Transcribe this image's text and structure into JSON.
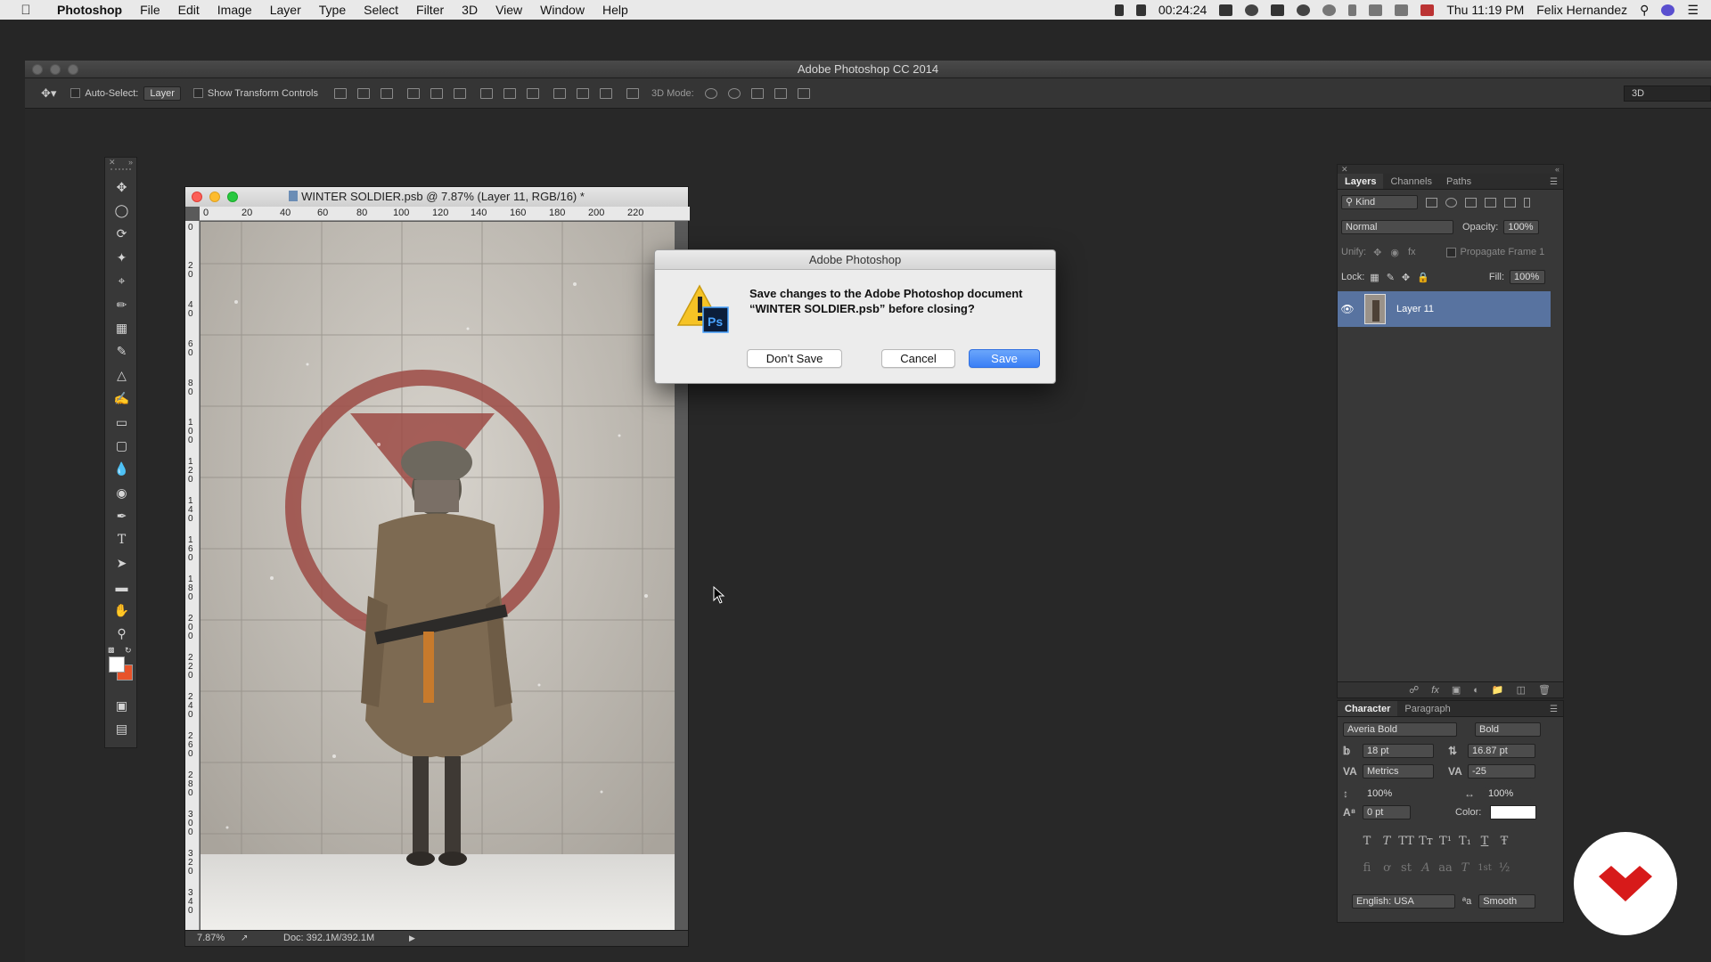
{
  "menubar": {
    "app": "Photoshop",
    "items": [
      "File",
      "Edit",
      "Image",
      "Layer",
      "Type",
      "Select",
      "Filter",
      "3D",
      "View",
      "Window",
      "Help"
    ],
    "timer": "00:24:24",
    "clock": "Thu 11:19 PM",
    "user": "Felix Hernandez"
  },
  "window": {
    "title": "Adobe Photoshop CC 2014"
  },
  "options": {
    "auto_select": "Auto-Select:",
    "auto_select_value": "Layer",
    "show_transform": "Show Transform Controls",
    "mode_label": "3D Mode:",
    "workspace": "3D"
  },
  "document": {
    "title": "WINTER SOLDIER.psb @ 7.87% (Layer 11, RGB/16) *",
    "hruler": [
      "0",
      "20",
      "40",
      "60",
      "80",
      "100",
      "120",
      "140",
      "160",
      "180",
      "200",
      "220"
    ],
    "vruler": [
      "0",
      "20",
      "40",
      "60",
      "80",
      "100",
      "120",
      "140",
      "160",
      "180",
      "200",
      "220",
      "240",
      "260",
      "280",
      "300",
      "320",
      "340"
    ],
    "zoom": "7.87%",
    "doc_size": "Doc: 392.1M/392.1M"
  },
  "dialog": {
    "title": "Adobe Photoshop",
    "message_line1": "Save changes to the Adobe Photoshop document",
    "message_line2": "“WINTER SOLDIER.psb” before closing?",
    "dont_save": "Don’t Save",
    "cancel": "Cancel",
    "save": "Save",
    "icon_label": "Ps"
  },
  "layers_panel": {
    "tabs": [
      "Layers",
      "Channels",
      "Paths"
    ],
    "filter": "Kind",
    "blend_mode": "Normal",
    "opacity_label": "Opacity:",
    "opacity": "100%",
    "unify_label": "Unify:",
    "propagate": "Propagate Frame 1",
    "lock_label": "Lock:",
    "fill_label": "Fill:",
    "fill": "100%",
    "layer_name": "Layer 11"
  },
  "character_panel": {
    "tabs": [
      "Character",
      "Paragraph"
    ],
    "font_family": "Averia Bold",
    "font_style": "Bold",
    "size": "18 pt",
    "leading": "16.87 pt",
    "kerning": "Metrics",
    "tracking": "-25",
    "vscale": "100%",
    "hscale": "100%",
    "baseline": "0 pt",
    "color_label": "Color:",
    "color_value": "#ffffff",
    "language": "English: USA",
    "aa_label": "ªa",
    "antialias": "Smooth",
    "type_buttons": [
      "T",
      "T",
      "TT",
      "Tт",
      "T¹",
      "T₁",
      "T",
      "Ŧ"
    ],
    "ot_buttons": [
      "fi",
      "ơ",
      "st",
      "A",
      "aa",
      "T",
      "1st",
      "½"
    ]
  },
  "colors": {
    "accent": "#3a7ff5",
    "selected_layer": "#5873a0",
    "badge": "#d71a1a"
  }
}
